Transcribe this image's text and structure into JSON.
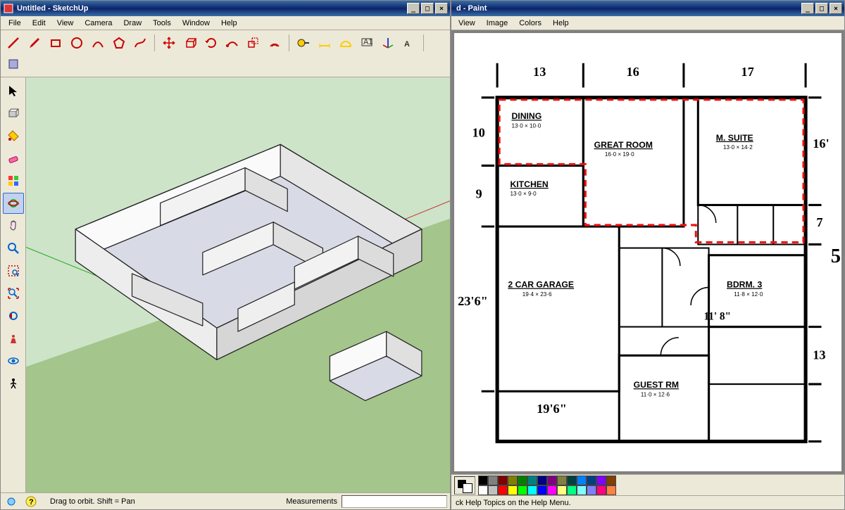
{
  "sketchup": {
    "title": "Untitled - SketchUp",
    "menu": [
      "File",
      "Edit",
      "View",
      "Camera",
      "Draw",
      "Tools",
      "Window",
      "Help"
    ],
    "top_tools": [
      "line",
      "rect",
      "circle",
      "arc",
      "polygon",
      "freehand",
      "move",
      "rotate",
      "scale",
      "offset",
      "push",
      "follow",
      "tape",
      "protractor",
      "dimension",
      "text",
      "axes",
      "3dtext",
      "section",
      "walk"
    ],
    "side_tools": [
      "select",
      "component",
      "paint",
      "eraser",
      "palette",
      "orbit",
      "pan",
      "zoom",
      "zoom-window",
      "zoom-extents",
      "prev-view",
      "iso",
      "rocket",
      "eyeball",
      "walk-side"
    ],
    "selected_side_tool": "orbit",
    "status_help_icon": "?",
    "status_hint": "Drag to orbit. Shift = Pan",
    "status_label_measurements": "Measurements"
  },
  "paint": {
    "title_suffix": "d - Paint",
    "menu": [
      "View",
      "Image",
      "Colors",
      "Help"
    ],
    "palette": [
      "#000000",
      "#808080",
      "#800000",
      "#808000",
      "#008000",
      "#008080",
      "#000080",
      "#800080",
      "#808040",
      "#004040",
      "#0080ff",
      "#004080",
      "#8000ff",
      "#804000",
      "#ffffff",
      "#c0c0c0",
      "#ff0000",
      "#ffff00",
      "#00ff00",
      "#00ffff",
      "#0000ff",
      "#ff00ff",
      "#ffff80",
      "#00ff80",
      "#80ffff",
      "#8080ff",
      "#ff0080",
      "#ff8040"
    ],
    "status": "ck Help Topics on the Help Menu."
  },
  "floorplan": {
    "rooms": [
      {
        "name": "DINING",
        "dim": "13·0 × 10·0"
      },
      {
        "name": "GREAT ROOM",
        "dim": "16·0 × 19·0"
      },
      {
        "name": "M. SUITE",
        "dim": "13·0 × 14·2"
      },
      {
        "name": "KITCHEN",
        "dim": "13·0 × 9·0"
      },
      {
        "name": "2 CAR GARAGE",
        "dim": "19·4 × 23·6"
      },
      {
        "name": "BDRM. 3",
        "dim": "11·8 × 12·0"
      },
      {
        "name": "GUEST RM",
        "dim": "11·0 × 12·6"
      }
    ],
    "hand_dims": {
      "top1": "13",
      "top2": "16",
      "top3": "17",
      "left1": "10",
      "left2": "9",
      "mid": "23'6\"",
      "bottom": "19'6\"",
      "right1": "16'",
      "right2": "7",
      "right3": "13",
      "right_outer": "5",
      "lower1": "11' 8\""
    }
  }
}
